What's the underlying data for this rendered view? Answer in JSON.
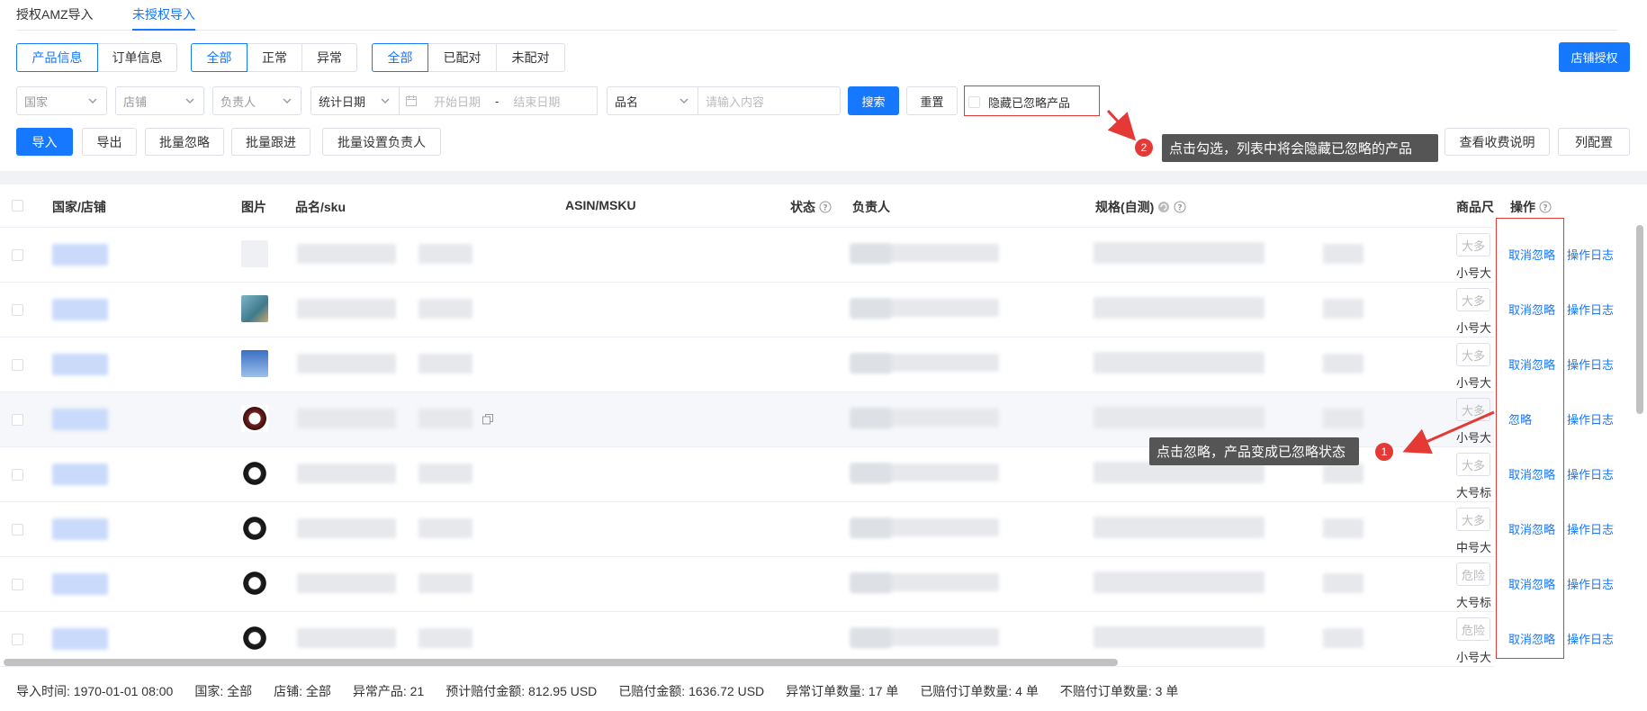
{
  "tabs": {
    "authorized": "授权AMZ导入",
    "unauthorized": "未授权导入"
  },
  "group_info": {
    "product": "产品信息",
    "order": "订单信息"
  },
  "group_status": {
    "all": "全部",
    "normal": "正常",
    "abnormal": "异常"
  },
  "group_match": {
    "all": "全部",
    "matched": "已配对",
    "unmatched": "未配对"
  },
  "store_auth": "店铺授权",
  "filters": {
    "country": "国家",
    "store": "店铺",
    "owner": "负责人",
    "stat_date": "统计日期",
    "start_date": "开始日期",
    "date_sep": "-",
    "end_date": "结束日期",
    "product_name": "品名",
    "search_placeholder": "请输入内容",
    "search": "搜索",
    "reset": "重置",
    "hide_ignored": "隐藏已忽略产品"
  },
  "actions": {
    "import": "导入",
    "export": "导出",
    "batch_ignore": "批量忽略",
    "batch_follow": "批量跟进",
    "batch_owner": "批量设置负责人",
    "fee_info": "查看收费说明",
    "columns": "列配置"
  },
  "tooltips": {
    "t2_num": "2",
    "t2": "点击勾选，列表中将会隐藏已忽略的产品",
    "t1_num": "1",
    "t1": "点击忽略，产品变成已忽略状态"
  },
  "columns": {
    "country_store": "国家/店铺",
    "image": "图片",
    "name_sku": "品名/sku",
    "asin": "ASIN/MSKU",
    "status": "状态",
    "owner": "负责人",
    "spec": "规格(自测)",
    "size": "商品尺",
    "ops": "操作"
  },
  "rows": [
    {
      "tag": "大多",
      "size": "小号大",
      "op1": "取消忽略",
      "op2": "操作日志"
    },
    {
      "tag": "大多",
      "size": "小号大",
      "op1": "取消忽略",
      "op2": "操作日志"
    },
    {
      "tag": "大多",
      "size": "小号大",
      "op1": "取消忽略",
      "op2": "操作日志"
    },
    {
      "tag": "大多",
      "size": "小号大",
      "op1": "忽略",
      "op2": "操作日志"
    },
    {
      "tag": "大多",
      "size": "大号标",
      "op1": "取消忽略",
      "op2": "操作日志"
    },
    {
      "tag": "大多",
      "size": "中号大",
      "op1": "取消忽略",
      "op2": "操作日志"
    },
    {
      "tag": "危险",
      "size": "大号标",
      "op1": "取消忽略",
      "op2": "操作日志"
    },
    {
      "tag": "危险",
      "size": "小号大",
      "op1": "取消忽略",
      "op2": "操作日志"
    }
  ],
  "footer": {
    "import_time": "导入时间: 1970-01-01 08:00",
    "country": "国家: 全部",
    "store": "店铺: 全部",
    "abnormal": "异常产品: 21",
    "est_comp": "预计赔付金额: 812.95 USD",
    "paid_comp": "已赔付金额: 1636.72 USD",
    "abn_orders": "异常订单数量: 17 单",
    "paid_orders": "已赔付订单数量: 4 单",
    "unpaid_orders": "不赔付订单数量: 3 单"
  },
  "colors": {
    "primary": "#1677ff",
    "annotation": "#e53935",
    "tooltip_bg": "#555555"
  }
}
